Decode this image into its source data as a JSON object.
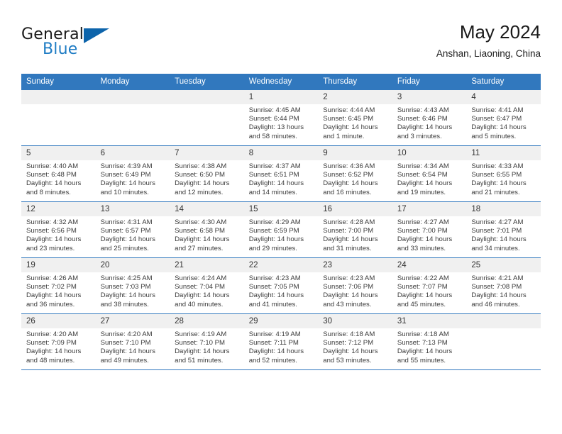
{
  "brand": {
    "name_top": "General",
    "name_bottom": "Blue",
    "flag_icon": "triangle-flag-icon",
    "accent_color": "#1f7cc4",
    "flag_color": "#0d64ab"
  },
  "header": {
    "title": "May 2024",
    "subtitle": "Anshan, Liaoning, China"
  },
  "calendar": {
    "header_bg": "#3178be",
    "daynum_bg": "#f0f0f0",
    "weekdays": [
      "Sunday",
      "Monday",
      "Tuesday",
      "Wednesday",
      "Thursday",
      "Friday",
      "Saturday"
    ],
    "weeks": [
      [
        {
          "day": "",
          "sunrise": "",
          "sunset": "",
          "daylight": "",
          "daylight2": ""
        },
        {
          "day": "",
          "sunrise": "",
          "sunset": "",
          "daylight": "",
          "daylight2": ""
        },
        {
          "day": "",
          "sunrise": "",
          "sunset": "",
          "daylight": "",
          "daylight2": ""
        },
        {
          "day": "1",
          "sunrise": "Sunrise: 4:45 AM",
          "sunset": "Sunset: 6:44 PM",
          "daylight": "Daylight: 13 hours",
          "daylight2": "and 58 minutes."
        },
        {
          "day": "2",
          "sunrise": "Sunrise: 4:44 AM",
          "sunset": "Sunset: 6:45 PM",
          "daylight": "Daylight: 14 hours",
          "daylight2": "and 1 minute."
        },
        {
          "day": "3",
          "sunrise": "Sunrise: 4:43 AM",
          "sunset": "Sunset: 6:46 PM",
          "daylight": "Daylight: 14 hours",
          "daylight2": "and 3 minutes."
        },
        {
          "day": "4",
          "sunrise": "Sunrise: 4:41 AM",
          "sunset": "Sunset: 6:47 PM",
          "daylight": "Daylight: 14 hours",
          "daylight2": "and 5 minutes."
        }
      ],
      [
        {
          "day": "5",
          "sunrise": "Sunrise: 4:40 AM",
          "sunset": "Sunset: 6:48 PM",
          "daylight": "Daylight: 14 hours",
          "daylight2": "and 8 minutes."
        },
        {
          "day": "6",
          "sunrise": "Sunrise: 4:39 AM",
          "sunset": "Sunset: 6:49 PM",
          "daylight": "Daylight: 14 hours",
          "daylight2": "and 10 minutes."
        },
        {
          "day": "7",
          "sunrise": "Sunrise: 4:38 AM",
          "sunset": "Sunset: 6:50 PM",
          "daylight": "Daylight: 14 hours",
          "daylight2": "and 12 minutes."
        },
        {
          "day": "8",
          "sunrise": "Sunrise: 4:37 AM",
          "sunset": "Sunset: 6:51 PM",
          "daylight": "Daylight: 14 hours",
          "daylight2": "and 14 minutes."
        },
        {
          "day": "9",
          "sunrise": "Sunrise: 4:36 AM",
          "sunset": "Sunset: 6:52 PM",
          "daylight": "Daylight: 14 hours",
          "daylight2": "and 16 minutes."
        },
        {
          "day": "10",
          "sunrise": "Sunrise: 4:34 AM",
          "sunset": "Sunset: 6:54 PM",
          "daylight": "Daylight: 14 hours",
          "daylight2": "and 19 minutes."
        },
        {
          "day": "11",
          "sunrise": "Sunrise: 4:33 AM",
          "sunset": "Sunset: 6:55 PM",
          "daylight": "Daylight: 14 hours",
          "daylight2": "and 21 minutes."
        }
      ],
      [
        {
          "day": "12",
          "sunrise": "Sunrise: 4:32 AM",
          "sunset": "Sunset: 6:56 PM",
          "daylight": "Daylight: 14 hours",
          "daylight2": "and 23 minutes."
        },
        {
          "day": "13",
          "sunrise": "Sunrise: 4:31 AM",
          "sunset": "Sunset: 6:57 PM",
          "daylight": "Daylight: 14 hours",
          "daylight2": "and 25 minutes."
        },
        {
          "day": "14",
          "sunrise": "Sunrise: 4:30 AM",
          "sunset": "Sunset: 6:58 PM",
          "daylight": "Daylight: 14 hours",
          "daylight2": "and 27 minutes."
        },
        {
          "day": "15",
          "sunrise": "Sunrise: 4:29 AM",
          "sunset": "Sunset: 6:59 PM",
          "daylight": "Daylight: 14 hours",
          "daylight2": "and 29 minutes."
        },
        {
          "day": "16",
          "sunrise": "Sunrise: 4:28 AM",
          "sunset": "Sunset: 7:00 PM",
          "daylight": "Daylight: 14 hours",
          "daylight2": "and 31 minutes."
        },
        {
          "day": "17",
          "sunrise": "Sunrise: 4:27 AM",
          "sunset": "Sunset: 7:00 PM",
          "daylight": "Daylight: 14 hours",
          "daylight2": "and 33 minutes."
        },
        {
          "day": "18",
          "sunrise": "Sunrise: 4:27 AM",
          "sunset": "Sunset: 7:01 PM",
          "daylight": "Daylight: 14 hours",
          "daylight2": "and 34 minutes."
        }
      ],
      [
        {
          "day": "19",
          "sunrise": "Sunrise: 4:26 AM",
          "sunset": "Sunset: 7:02 PM",
          "daylight": "Daylight: 14 hours",
          "daylight2": "and 36 minutes."
        },
        {
          "day": "20",
          "sunrise": "Sunrise: 4:25 AM",
          "sunset": "Sunset: 7:03 PM",
          "daylight": "Daylight: 14 hours",
          "daylight2": "and 38 minutes."
        },
        {
          "day": "21",
          "sunrise": "Sunrise: 4:24 AM",
          "sunset": "Sunset: 7:04 PM",
          "daylight": "Daylight: 14 hours",
          "daylight2": "and 40 minutes."
        },
        {
          "day": "22",
          "sunrise": "Sunrise: 4:23 AM",
          "sunset": "Sunset: 7:05 PM",
          "daylight": "Daylight: 14 hours",
          "daylight2": "and 41 minutes."
        },
        {
          "day": "23",
          "sunrise": "Sunrise: 4:23 AM",
          "sunset": "Sunset: 7:06 PM",
          "daylight": "Daylight: 14 hours",
          "daylight2": "and 43 minutes."
        },
        {
          "day": "24",
          "sunrise": "Sunrise: 4:22 AM",
          "sunset": "Sunset: 7:07 PM",
          "daylight": "Daylight: 14 hours",
          "daylight2": "and 45 minutes."
        },
        {
          "day": "25",
          "sunrise": "Sunrise: 4:21 AM",
          "sunset": "Sunset: 7:08 PM",
          "daylight": "Daylight: 14 hours",
          "daylight2": "and 46 minutes."
        }
      ],
      [
        {
          "day": "26",
          "sunrise": "Sunrise: 4:20 AM",
          "sunset": "Sunset: 7:09 PM",
          "daylight": "Daylight: 14 hours",
          "daylight2": "and 48 minutes."
        },
        {
          "day": "27",
          "sunrise": "Sunrise: 4:20 AM",
          "sunset": "Sunset: 7:10 PM",
          "daylight": "Daylight: 14 hours",
          "daylight2": "and 49 minutes."
        },
        {
          "day": "28",
          "sunrise": "Sunrise: 4:19 AM",
          "sunset": "Sunset: 7:10 PM",
          "daylight": "Daylight: 14 hours",
          "daylight2": "and 51 minutes."
        },
        {
          "day": "29",
          "sunrise": "Sunrise: 4:19 AM",
          "sunset": "Sunset: 7:11 PM",
          "daylight": "Daylight: 14 hours",
          "daylight2": "and 52 minutes."
        },
        {
          "day": "30",
          "sunrise": "Sunrise: 4:18 AM",
          "sunset": "Sunset: 7:12 PM",
          "daylight": "Daylight: 14 hours",
          "daylight2": "and 53 minutes."
        },
        {
          "day": "31",
          "sunrise": "Sunrise: 4:18 AM",
          "sunset": "Sunset: 7:13 PM",
          "daylight": "Daylight: 14 hours",
          "daylight2": "and 55 minutes."
        },
        {
          "day": "",
          "sunrise": "",
          "sunset": "",
          "daylight": "",
          "daylight2": ""
        }
      ]
    ]
  }
}
